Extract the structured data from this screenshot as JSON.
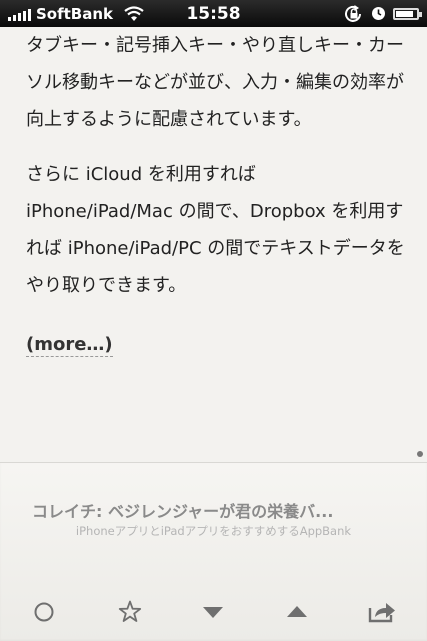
{
  "status_bar": {
    "carrier": "SoftBank",
    "time": "15:58",
    "battery_level": 0.85,
    "icons": [
      "signal-icon",
      "wifi-icon",
      "rotation-lock-icon",
      "alarm-icon",
      "battery-icon"
    ]
  },
  "article": {
    "paragraph1": "タブキー・記号挿入キー・やり直しキー・カーソル移動キーなどが並び、入力・編集の効率が向上するように配慮されています。",
    "paragraph2": "さらに iCloud を利用すれば iPhone/iPad/Mac の間で、Dropbox を利用すれば iPhone/iPad/PC の間でテキストデータをやり取りできます。",
    "more_link": "(more…)"
  },
  "next_article": {
    "title": "コレイチ: ベジレンジャーが君の栄養バ...",
    "source": "iPhoneアプリとiPadアプリをおすすめするAppBank"
  },
  "toolbar": {
    "icons": [
      "circle-icon",
      "star-icon",
      "down-arrow-icon",
      "up-arrow-icon",
      "share-icon"
    ]
  },
  "colors": {
    "background": "#f3f2ef",
    "text": "#222222",
    "muted": "#8a8a8a",
    "icon": "#6f6f6f"
  }
}
